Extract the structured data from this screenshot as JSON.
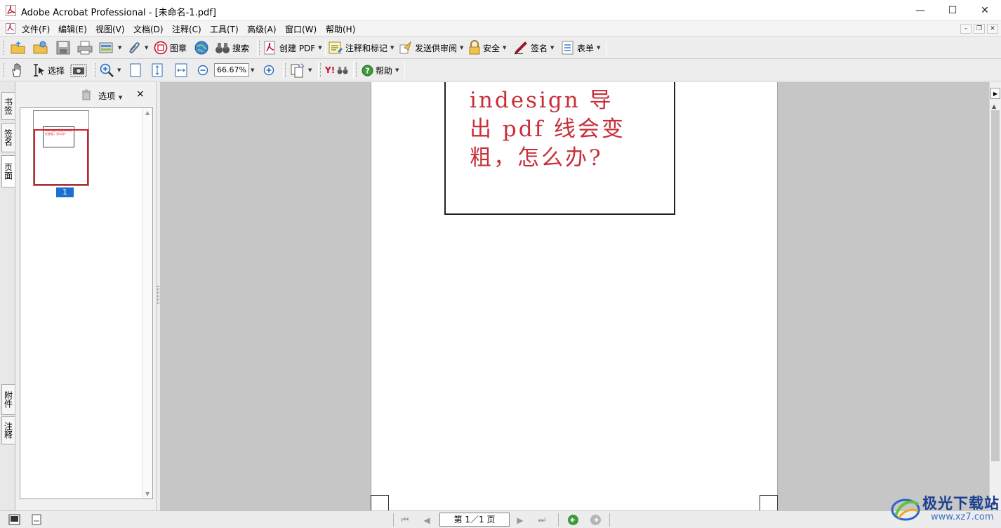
{
  "window": {
    "title": "Adobe Acrobat Professional - [未命名-1.pdf]",
    "minimize_glyph": "—",
    "maximize_glyph": "☐",
    "close_glyph": "✕"
  },
  "menu": {
    "items": [
      "文件(F)",
      "编辑(E)",
      "视图(V)",
      "文档(D)",
      "注释(C)",
      "工具(T)",
      "高级(A)",
      "窗口(W)",
      "帮助(H)"
    ],
    "mdi_minimize": "–",
    "mdi_restore": "❐",
    "mdi_close": "✕"
  },
  "toolbar1": {
    "stamp": "图章",
    "search": "搜索",
    "create_pdf": "创建 PDF",
    "comment_markup": "注释和标记",
    "send_review": "发送供审阅",
    "security": "安全",
    "sign": "签名",
    "forms": "表单"
  },
  "toolbar2": {
    "select": "选择",
    "zoom_value": "66.67%",
    "yahoo": "Y!",
    "help": "帮助"
  },
  "left_tabs": {
    "bookmarks": "书签",
    "signatures": "签名",
    "pages": "页面",
    "attachments": "附件",
    "comments": "注释"
  },
  "pages_panel": {
    "options": "选项",
    "close": "×",
    "thumbnail_label": "1",
    "thumbnail_text": "indesign 导出 pdf线会变粗，怎么办?"
  },
  "document": {
    "text_line1": "indesign 导",
    "text_line2": "出 pdf 线会变",
    "text_line3": "粗，怎么办?"
  },
  "statusbar": {
    "page_field": "第 1／1 页"
  },
  "watermark": {
    "main": "极光下载站",
    "sub": "www.xz7.com"
  },
  "colors": {
    "doc_text": "#c7303a",
    "selection_frame": "#d0202a",
    "page_badge": "#1e6fd0",
    "acrobat_red": "#c8102e"
  }
}
